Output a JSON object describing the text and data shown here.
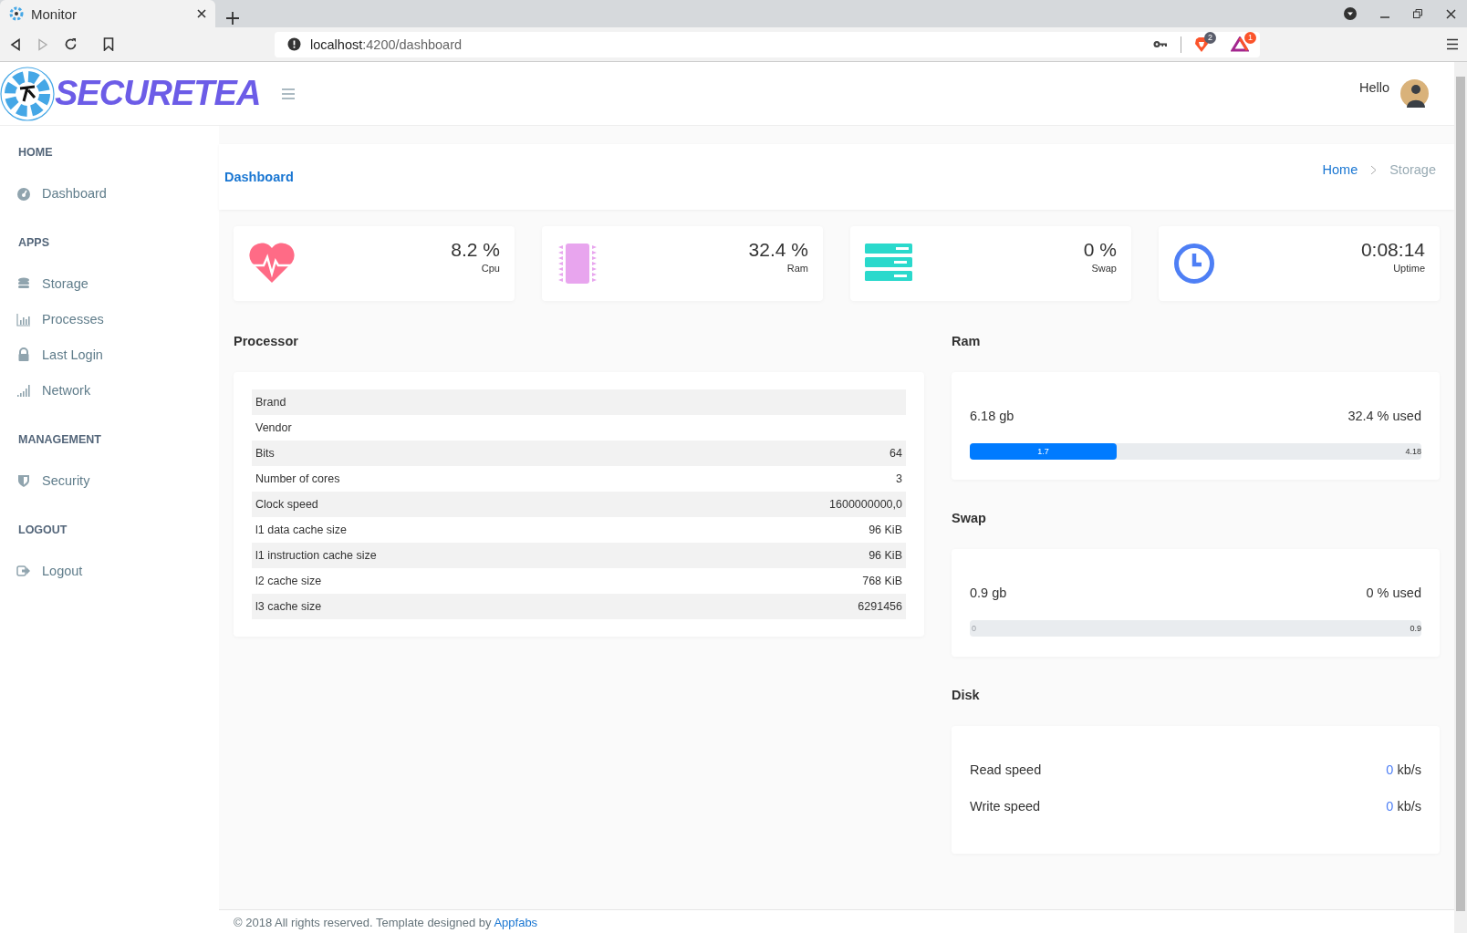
{
  "browser": {
    "tab_title": "Monitor",
    "url_host": "localhost",
    "url_path": ":4200/dashboard",
    "shield_badge": "2",
    "rewards_badge": "1"
  },
  "header": {
    "logo_text": "SECURETEA",
    "greeting": "Hello"
  },
  "sidebar": {
    "sections": [
      {
        "title": "HOME",
        "items": [
          {
            "label": "Dashboard",
            "kind": "gauge",
            "selected": false
          }
        ]
      },
      {
        "title": "APPS",
        "items": [
          {
            "label": "Storage",
            "kind": "database",
            "selected": false
          },
          {
            "label": "Processes",
            "kind": "bars",
            "selected": false
          },
          {
            "label": "Last Login",
            "kind": "lock",
            "selected": false
          },
          {
            "label": "Network",
            "kind": "signal",
            "selected": false
          }
        ]
      },
      {
        "title": "MANAGEMENT",
        "items": [
          {
            "label": "Security",
            "kind": "shield",
            "selected": false
          }
        ]
      },
      {
        "title": "LOGOUT",
        "items": [
          {
            "label": "Logout",
            "kind": "signout",
            "selected": false
          }
        ]
      }
    ]
  },
  "page": {
    "title": "Dashboard",
    "breadcrumb": [
      {
        "label": "Home",
        "kind": "link"
      },
      {
        "label": "Storage",
        "kind": "current"
      }
    ]
  },
  "stats": [
    {
      "value": "8.2 %",
      "label": "Cpu",
      "kind": "heart",
      "color": "#ff6b86"
    },
    {
      "value": "32.4 %",
      "label": "Ram",
      "kind": "chip",
      "color": "#e8a5ee"
    },
    {
      "value": "0 %",
      "label": "Swap",
      "kind": "server",
      "color": "#2ad9cc"
    },
    {
      "value": "0:08:14",
      "label": "Uptime",
      "kind": "clock",
      "color": "#4e7ff5"
    }
  ],
  "processor": {
    "title": "Processor",
    "rows": [
      {
        "label": "Brand"
      },
      {
        "label": "Vendor"
      },
      {
        "label": "Bits",
        "value": "64"
      },
      {
        "label": "Number of cores",
        "value": "3"
      },
      {
        "label": "Clock speed",
        "value": "1600000000,0"
      },
      {
        "label": "l1 data cache size",
        "value": "96 KiB"
      },
      {
        "label": "l1 instruction cache size",
        "value": "96 KiB"
      },
      {
        "label": "l2 cache size",
        "value": "768 KiB"
      },
      {
        "label": "l3 cache size",
        "value": "6291456"
      }
    ]
  },
  "ram": {
    "title": "Ram",
    "total": "6.18 gb",
    "used": "32.4 % used",
    "level": 0.325,
    "fill_label": "1.7",
    "end_label": "4.18"
  },
  "swap": {
    "title": "Swap",
    "total": "0.9 gb",
    "used": "0 % used",
    "level": 0,
    "fill_label": "0",
    "end_label": "0.9"
  },
  "disk": {
    "title": "Disk",
    "rows": [
      {
        "label": "Read speed",
        "value": "0",
        "unit": "kb/s"
      },
      {
        "label": "Write speed",
        "value": "0",
        "unit": "kb/s"
      }
    ]
  },
  "footer": {
    "text": "© 2018 All rights reserved. Template designed by ",
    "link": "Appfabs"
  }
}
